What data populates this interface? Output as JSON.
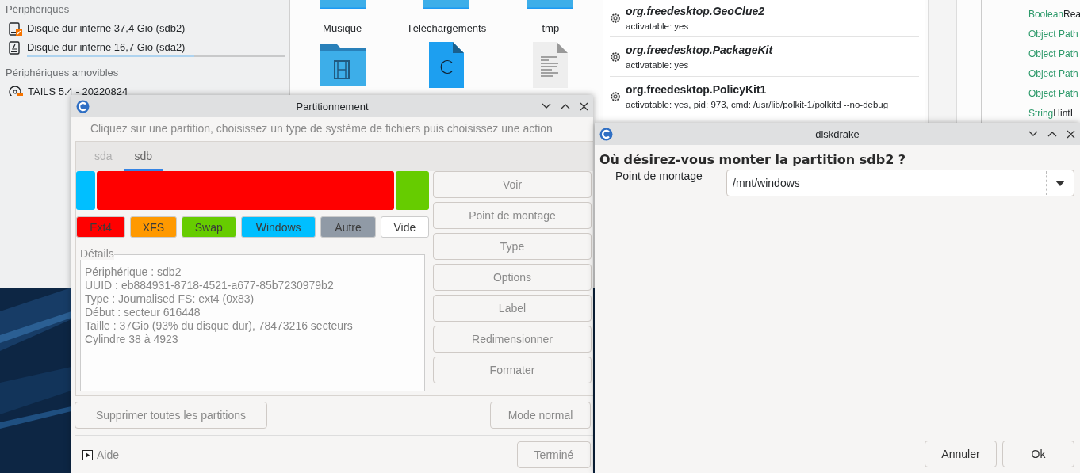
{
  "file_manager": {
    "places": [
      {
        "heading": "Périphériques",
        "items": [
          {
            "kind": "hdd",
            "label": "Disque dur interne 37,4 Gio (sdb2)"
          },
          {
            "kind": "hdd-linux",
            "label": "Disque dur interne 16,7 Gio (sda2)",
            "level": 0.65
          }
        ]
      },
      {
        "heading": "Périphériques amovibles",
        "items": [
          {
            "kind": "disc",
            "label": "TAILS 5.4 - 20220824"
          }
        ]
      }
    ],
    "files": [
      {
        "kind": "folder",
        "name": "Musique",
        "selected": false
      },
      {
        "kind": "folder",
        "name": "Téléchargements",
        "selected": true
      },
      {
        "kind": "folder",
        "name": "tmp",
        "selected": false
      },
      {
        "kind": "video-folder"
      },
      {
        "kind": "c-source"
      },
      {
        "kind": "text"
      }
    ]
  },
  "dbus_viewer": {
    "services": [
      {
        "name": "org.freedesktop.GeoClue2",
        "running": false,
        "info": "activatable: yes"
      },
      {
        "name": "org.freedesktop.PackageKit",
        "running": false,
        "info": "activatable: yes"
      },
      {
        "name": "org.freedesktop.PolicyKit1",
        "running": true,
        "info": "activatable: yes, pid: 973, cmd: /usr/lib/polkit-1/polkitd --no-debug"
      }
    ],
    "tree": [
      {
        "type": "Boolean",
        "name": "Rea"
      },
      {
        "type": "Object Path"
      },
      {
        "type": "Object Path"
      },
      {
        "type": "Object Path"
      },
      {
        "type": "Object Path"
      },
      {
        "type": "String",
        "name": "HintI"
      }
    ]
  },
  "partitioning": {
    "title": "Partitionnement",
    "instruction": "Cliquez sur une partition, choisissez un type de système de fichiers puis choisissez une action",
    "tabs": [
      {
        "label": "sda",
        "selected": false
      },
      {
        "label": "sdb",
        "selected": true
      }
    ],
    "partitions": [
      {
        "color": "#00bfff"
      },
      {
        "color": "#ff0000"
      },
      {
        "color": "#66cc00"
      }
    ],
    "legend": [
      {
        "label": "Ext4",
        "color": "#ff0000"
      },
      {
        "label": "XFS",
        "color": "#ff9900"
      },
      {
        "label": "Swap",
        "color": "#66cc00"
      },
      {
        "label": "Windows",
        "color": "#00bfff"
      },
      {
        "label": "Autre",
        "color": "#909aa6"
      },
      {
        "label": "Vide",
        "color": "#ffffff"
      }
    ],
    "details_title": "Détails",
    "details": [
      "Périphérique : sdb2",
      "UUID : eb884931-8718-4521-a677-85b7230979b2",
      "Type : Journalised FS: ext4 (0x83)",
      "Début : secteur 616448",
      "Taille : 37Gio (93% du disque dur), 78473216 secteurs",
      "Cylindre 38 à 4923"
    ],
    "actions": [
      "Voir",
      "Point de montage",
      "Type",
      "Options",
      "Label",
      "Redimensionner",
      "Formater"
    ],
    "clear_button": "Supprimer toutes les partitions",
    "mode_button": "Mode normal",
    "help": "Aide",
    "done_button": "Terminé"
  },
  "diskdrake": {
    "title": "diskdrake",
    "question": "Où désirez-vous monter la partition sdb2 ?",
    "field_label": "Point de montage",
    "value": "/mnt/windows",
    "buttons": [
      "Annuler",
      "Ok"
    ]
  }
}
